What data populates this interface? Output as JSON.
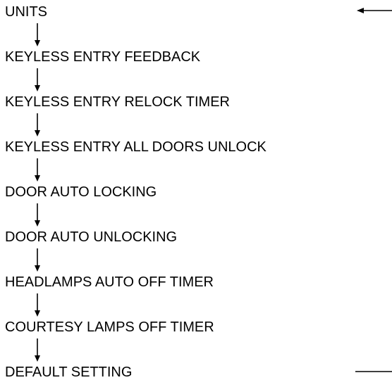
{
  "diagram": {
    "steps": [
      "UNITS",
      "KEYLESS ENTRY FEEDBACK",
      "KEYLESS ENTRY RELOCK TIMER",
      "KEYLESS ENTRY ALL DOORS UNLOCK",
      "DOOR AUTO LOCKING",
      "DOOR AUTO UNLOCKING",
      "HEADLAMPS AUTO OFF TIMER",
      "COURTESY LAMPS OFF TIMER",
      "DEFAULT SETTING"
    ],
    "line_color": "#000000",
    "text_color": "#000000",
    "return_loop": {
      "from_step": "DEFAULT SETTING",
      "to_step": "UNITS",
      "direction": "return-to-first-step"
    }
  }
}
